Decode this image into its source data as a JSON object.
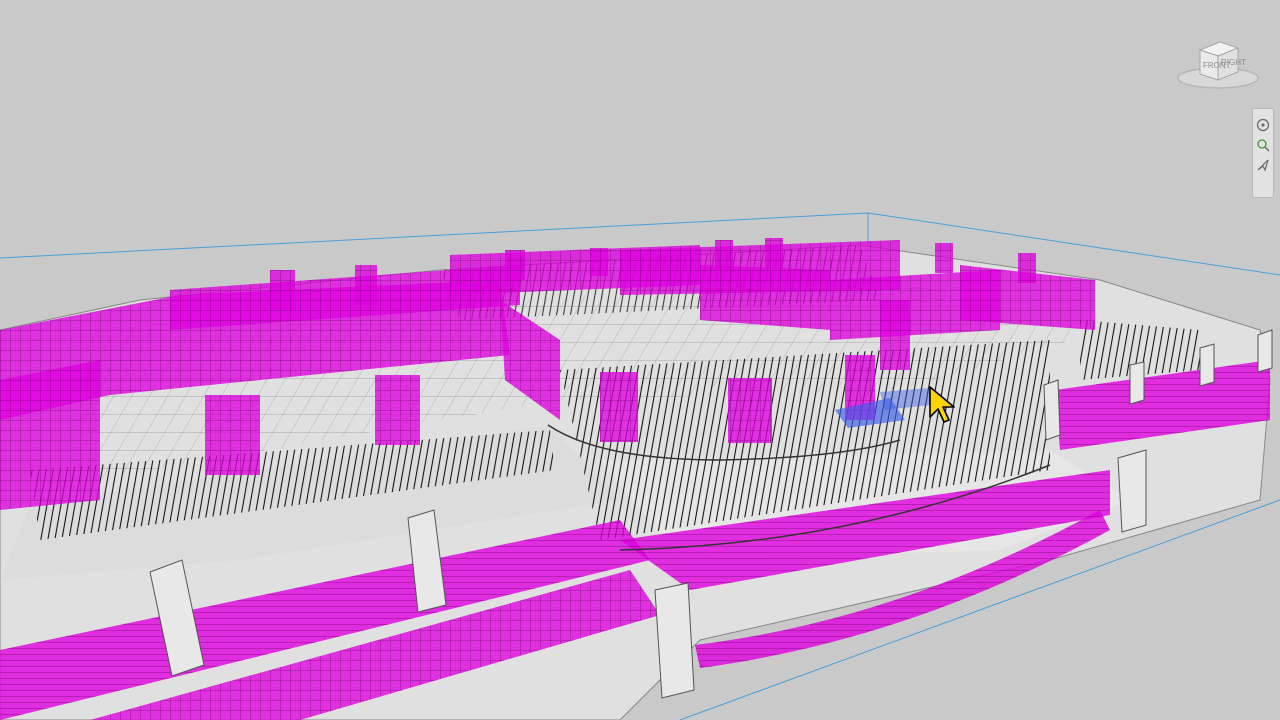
{
  "viewcube": {
    "front_label": "FRONT",
    "right_label": "RIGHT"
  },
  "navigation_bar": {
    "items": [
      {
        "icon": "steering-wheel-icon"
      },
      {
        "icon": "zoom-icon"
      },
      {
        "icon": "pan-icon"
      }
    ]
  },
  "colors": {
    "background": "#c9c9c9",
    "rebar_highlight": "#e000e0",
    "concrete": "#e4e4e4",
    "rebar_lines": "#1a1a1a",
    "section_box": "#4a9fd8",
    "selection": "#3a5ee8",
    "cursor": "#ffd400"
  }
}
